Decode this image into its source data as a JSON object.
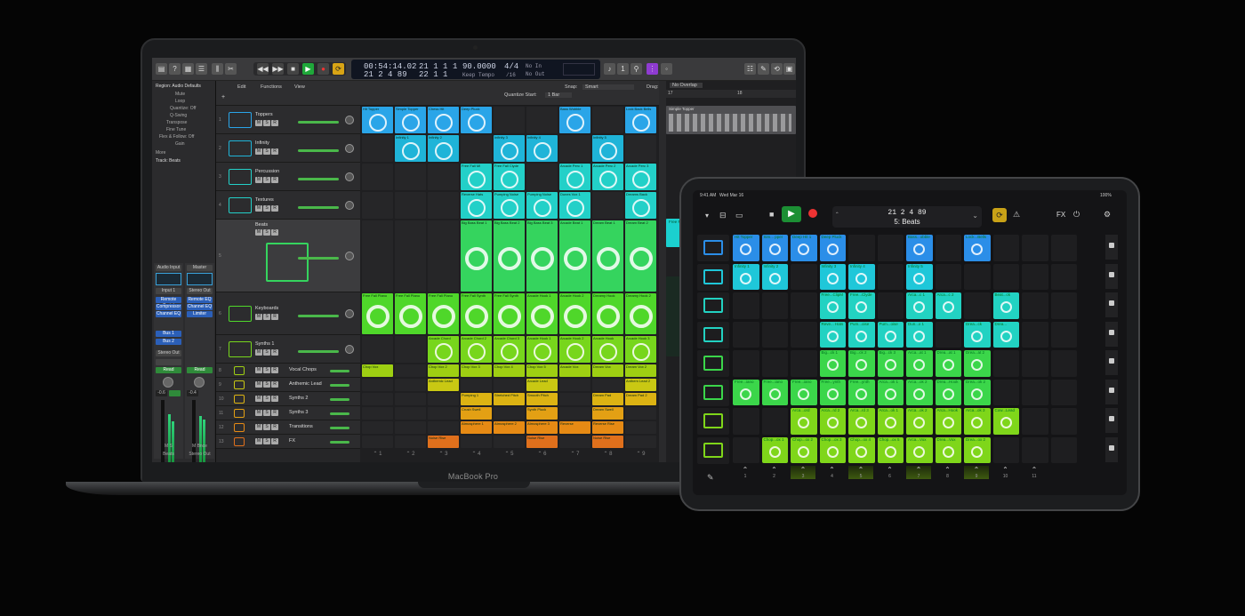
{
  "macbook": {
    "label": "MacBook Pro",
    "transport": {
      "time": "00:54:14.02",
      "bars": "21 1 1",
      "bars_sub": "21 2 4 89",
      "beat": "1",
      "beat_sub": "22 1 1",
      "tempo": "90.0000",
      "tempo_label": "Keep Tempo",
      "sig": "4/4",
      "division": "/16",
      "in_label": "No In",
      "out_label": "No Out"
    },
    "inspector": {
      "region": "Region: Audio Defaults",
      "rows": [
        "Mute",
        "Loop",
        "Quantize: Off",
        "Q-Swing",
        "Transpose",
        "Fine Tune",
        "Flex & Follow: Off",
        "Gain"
      ],
      "more": "More",
      "track": "Track: Beats",
      "strip1": [
        "Audio Input",
        "Input 1",
        "Remote Script",
        "Compressor",
        "Channel EQ"
      ],
      "strip2": [
        "Master",
        "Stereo Out",
        "Remote EQ",
        "Channel EQ",
        "Limiter"
      ],
      "bus": "Bus 1",
      "bus2": "Bus 2",
      "stereo_out": "Stereo Out",
      "read": "Read",
      "db1": "-0.6",
      "db2": "-0.4",
      "strip_name_1": "Beats",
      "strip_name_2": "Stereo Out"
    },
    "toolbar": {
      "edit": "Edit",
      "functions": "Functions",
      "view": "View",
      "snap": "Snap:",
      "snap_value": "Smart",
      "drag": "Drag:",
      "drag_value": "No Overlap",
      "quantize": "Quantize Start:",
      "quantize_value": "1 Bar"
    },
    "tracks": [
      {
        "n": "1",
        "name": "Toppers",
        "color": "#2aa5e8"
      },
      {
        "n": "2",
        "name": "Infinity",
        "color": "#1fb4d8"
      },
      {
        "n": "3",
        "name": "Percussion",
        "color": "#23d0c8"
      },
      {
        "n": "4",
        "name": "Textures",
        "color": "#23d0c8"
      },
      {
        "n": "5",
        "name": "Beats",
        "color": "#35d45e"
      },
      {
        "n": "6",
        "name": "Keyboards",
        "color": "#4fd72a"
      },
      {
        "n": "7",
        "name": "Synths 1",
        "color": "#77d61c"
      },
      {
        "n": "8",
        "name": "Vocal Chops",
        "color": "#9ecf12"
      },
      {
        "n": "9",
        "name": "Anthemic Lead",
        "color": "#c9c813"
      },
      {
        "n": "10",
        "name": "Synths 2",
        "color": "#dcb313"
      },
      {
        "n": "11",
        "name": "Synths 3",
        "color": "#e3a014"
      },
      {
        "n": "12",
        "name": "Transitions",
        "color": "#e68a14"
      },
      {
        "n": "13",
        "name": "FX",
        "color": "#e0701c"
      }
    ],
    "cells": {
      "row1": [
        "Hit Topper",
        "Simple Topper",
        "Chess Hit",
        "Deep Pluck",
        "",
        "",
        "Bass Wobble",
        "",
        "Lock Back Bells"
      ],
      "row2": [
        "",
        "Infinity 1",
        "Infinity 2",
        "",
        "Infinity 3",
        "Infinity 4",
        "",
        "Infinity 5",
        ""
      ],
      "row3": [
        "",
        "",
        "",
        "Free Fall Ml",
        "Free Fall Clyde",
        "",
        "Arcade Perc 1",
        "Arcade Perc 2",
        "Arcade Perc 3"
      ],
      "row4": [
        "",
        "",
        "",
        "Reverse Hats",
        "Pumping Noise",
        "Pumping Noise",
        "Dunes Vox 1",
        "",
        "Dreams Back"
      ],
      "row5": [
        "",
        "",
        "",
        "Big Bass Beat 1",
        "Big Bass Beat 2",
        "Big Bass Beat 3",
        "Arcade Beat 1",
        "Dream Beat 1",
        "Dream Beat 2"
      ],
      "row6": [
        "Free Fall Piano",
        "Free Fall Piano",
        "Free Fall Piano",
        "Free Fall Synth",
        "Free Fall Synth",
        "Arcade Hook 1",
        "Arcade Hook 2",
        "Dreamy Hook",
        "Dreamy Hook 2"
      ],
      "row7": [
        "",
        "",
        "Arcade Chord",
        "Arcade Chord 2",
        "Arcade Chord 3",
        "Arcade Hook 1",
        "Arcade Hook 2",
        "Arcade Hook",
        "Arcade Hook 3"
      ],
      "row8": [
        "Chop Vox",
        "",
        "Chop Vox 2",
        "Chop Vox 3",
        "Chop Vox 4",
        "Chop Vox 5",
        "Arcade Vox",
        "Dream Vox",
        "Dream Vox 2"
      ],
      "row9": [
        "",
        "",
        "Anthemic Lead",
        "",
        "",
        "Arcade Lead",
        "",
        "",
        "Anthem Lead 2"
      ],
      "row10": [
        "",
        "",
        "",
        "Pumping 1",
        "Stretched Pitch",
        "Smooth Pitch",
        "",
        "Dream Pad",
        "Dream Pad 2"
      ],
      "row11": [
        "",
        "",
        "",
        "Crush Swell",
        "",
        "Synth Pluck",
        "",
        "Dream Swell",
        ""
      ],
      "row12": [
        "",
        "",
        "",
        "Atmosphere 1",
        "Atmosphere 2",
        "Atmosphere 3",
        "Reverse",
        "Reverse Rise",
        ""
      ],
      "row13": [
        "",
        "",
        "Noise Rise",
        "",
        "",
        "Noise Rise",
        "",
        "Noise Rise",
        ""
      ]
    },
    "triggers": [
      "1",
      "2",
      "3",
      "4",
      "5",
      "6",
      "7",
      "8",
      "9"
    ],
    "timeline": {
      "bar_a": "17",
      "bar_b": "18",
      "region1": "Simple Topper",
      "region2": "Free Fall Piano 1"
    }
  },
  "ipad": {
    "status_time": "9:41 AM",
    "status_date": "Wed Mar 16",
    "battery": "100%",
    "lcd_top": "21 2 4   89",
    "lcd_bottom": "5: Beats",
    "fx_label": "FX",
    "triggers": [
      "1",
      "2",
      "3",
      "4",
      "5",
      "6",
      "7",
      "8",
      "9",
      "10",
      "11"
    ],
    "rows": [
      [
        "Hit Topper",
        "Sim... pper",
        "Deep Hit 1",
        "Deep Pluck",
        "",
        "",
        "Bass...obble",
        "",
        "Lock...Bells",
        ""
      ],
      [
        "Infinity 1",
        "Infinity 2",
        "",
        "Infinity 3",
        "Infinity 4",
        "",
        "Infinity 5",
        "",
        "",
        ""
      ],
      [
        "",
        "",
        "",
        "Free...ClipM",
        "Free...Clyde",
        "",
        "Arca...c 1",
        "Arca...c 2",
        "",
        "Beat...ck"
      ],
      [
        "",
        "",
        "",
        "Reve... Hats",
        "Pum...oise",
        "Pum...oise",
        "Dun...x 1",
        "",
        "Drea...ck",
        "Drea..."
      ],
      [
        "",
        "",
        "",
        "Big...ck 1",
        "Big...ck 2",
        "Big...ck 3",
        "Arca...at 1",
        "Drea...at 1",
        "Drea...at 2",
        ""
      ],
      [
        "Free...iano",
        "Free...iano",
        "Free...iano",
        "Free...ynth",
        "Free...ynth",
        "Arca...ok 1",
        "Arca...ok 2",
        "Drea...Hook",
        "Drea...ok 2",
        ""
      ],
      [
        "",
        "",
        "Arca...ord",
        "Arca...rd 2",
        "Arca...rd 3",
        "Arca...ok 1",
        "Arca...ok 2",
        "Arca...Hook",
        "Arca...ok 3",
        "Cow...Lead"
      ],
      [
        "",
        "Chop...ox 1",
        "Chop...ox 2",
        "Chop...ox 3",
        "Chop...ox 4",
        "Chop...ox 5",
        "Arca...Vox",
        "Drea...Vox",
        "Drea...ox 2",
        ""
      ]
    ]
  },
  "colors": {
    "blue": "#2b8ee8",
    "cyan": "#1fc7d9",
    "teal": "#22d2c2",
    "green": "#3bd64a",
    "lime": "#7fd61a",
    "yellow": "#cfc612",
    "orange": "#e58a15"
  }
}
